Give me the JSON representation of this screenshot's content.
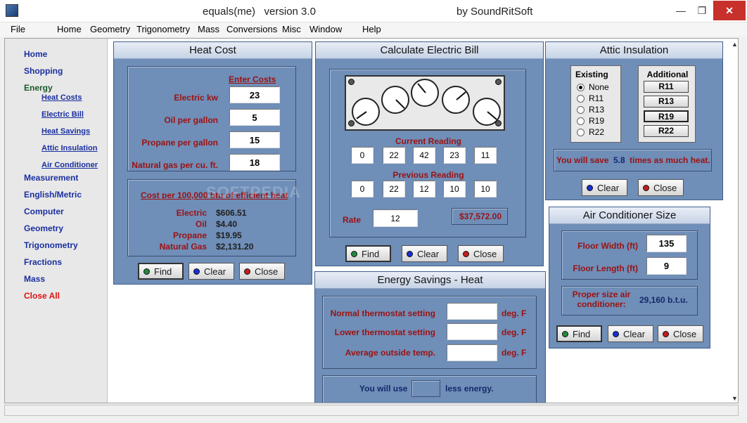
{
  "window": {
    "title_app": "equals(me)   version 3.0",
    "title_vendor": "by SoundRitSoft",
    "min_glyph": "—",
    "restore_glyph": "❐",
    "close_glyph": "✕"
  },
  "menu": [
    "File",
    "Home",
    "Geometry",
    "Trigonometry",
    "Mass",
    "Conversions",
    "Misc",
    "Window",
    "Help"
  ],
  "sidebar": {
    "items": [
      "Home",
      "Shopping",
      "Energy"
    ],
    "energy_sub": [
      "Heat Costs",
      "Electric Bill",
      "Heat Savings",
      "Attic Insulation",
      "Air Conditioner"
    ],
    "more": [
      "Measurement",
      "English/Metric",
      "Computer",
      "Geometry",
      "Trigonometry",
      "Fractions",
      "Mass"
    ],
    "close_all": "Close All"
  },
  "heat_cost": {
    "title": "Heat Cost",
    "enter_costs": "Enter Costs",
    "fields": [
      {
        "label": "Electric kw",
        "value": "23"
      },
      {
        "label": "Oil per gallon",
        "value": "5"
      },
      {
        "label": "Propane per gallon",
        "value": "15"
      },
      {
        "label": "Natural gas per cu. ft.",
        "value": "18"
      }
    ],
    "result_heading": "Cost per 100,000 btu of efficient heat",
    "results": [
      {
        "label": "Electric",
        "value": "$606.51"
      },
      {
        "label": "Oil",
        "value": "$4.40"
      },
      {
        "label": "Propane",
        "value": "$19.95"
      },
      {
        "label": "Natural Gas",
        "value": "$2,131.20"
      }
    ],
    "find": "Find",
    "clear": "Clear",
    "close": "Close"
  },
  "electric_bill": {
    "title": "Calculate Electric Bill",
    "current_label": "Current Reading",
    "current": [
      "0",
      "22",
      "42",
      "23",
      "11"
    ],
    "previous_label": "Previous Reading",
    "previous": [
      "0",
      "22",
      "12",
      "10",
      "10"
    ],
    "rate_label": "Rate",
    "rate": "12",
    "total": "$37,572.00",
    "find": "Find",
    "clear": "Clear",
    "close": "Close"
  },
  "attic": {
    "title": "Attic Insulation",
    "existing_label": "Existing",
    "existing_options": [
      "None",
      "R11",
      "R13",
      "R19",
      "R22"
    ],
    "existing_selected": "None",
    "additional_label": "Additional",
    "additional_options": [
      "R11",
      "R13",
      "R19",
      "R22"
    ],
    "save_prefix": "You will save",
    "save_value": "5.8",
    "save_suffix": "times as much heat.",
    "clear": "Clear",
    "close": "Close"
  },
  "air_conditioner": {
    "title": "Air Conditioner Size",
    "width_label": "Floor Width (ft)",
    "width": "135",
    "length_label": "Floor Length (ft)",
    "length": "9",
    "result_label": "Proper size air conditioner:",
    "result_value": "29,160 b.t.u.",
    "find": "Find",
    "clear": "Clear",
    "close": "Close"
  },
  "energy_savings": {
    "title": "Energy Savings - Heat",
    "fields": [
      {
        "label": "Normal thermostat setting",
        "unit": "deg. F",
        "value": ""
      },
      {
        "label": "Lower thermostat setting",
        "unit": "deg. F",
        "value": ""
      },
      {
        "label": "Average outside temp.",
        "unit": "deg. F",
        "value": ""
      }
    ],
    "use_prefix": "You will use",
    "use_value": "",
    "use_suffix": "less energy."
  },
  "watermark": "SOFTPEDIA",
  "colors": {
    "panel": "#6f8eb8",
    "label_red": "#9b1212",
    "nav_blue": "#1a2fa0",
    "close_all": "#e01010"
  }
}
